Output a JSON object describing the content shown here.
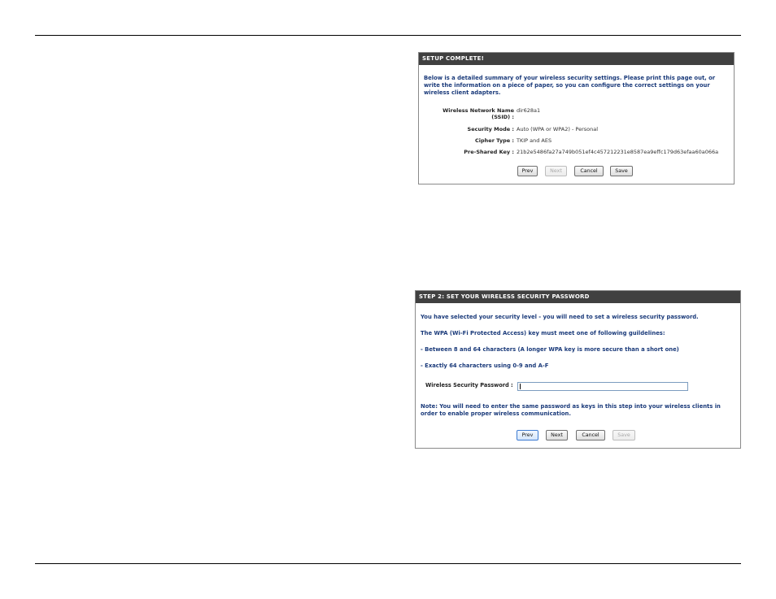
{
  "setup_complete": {
    "title": "SETUP COMPLETE!",
    "intro": "Below is a detailed summary of your wireless security settings. Please print this page out, or write the information on a piece of paper, so you can configure the correct settings on your wireless client adapters.",
    "fields": [
      {
        "label": "Wireless Network Name",
        "label2": "(SSID) :",
        "value": "dir628a1"
      },
      {
        "label": "Security Mode :",
        "value": "Auto (WPA or WPA2) - Personal"
      },
      {
        "label": "Cipher Type :",
        "value": "TKIP and AES"
      },
      {
        "label": "Pre-Shared Key :",
        "value": "21b2e5486fa27a749b051ef4c457212231e8587ea9effc179d63efaa60a066a"
      }
    ],
    "buttons": {
      "prev": "Prev",
      "next": "Next",
      "cancel": "Cancel",
      "save": "Save"
    },
    "next_enabled": false
  },
  "step2": {
    "title": "STEP 2: SET YOUR WIRELESS SECURITY PASSWORD",
    "lines": [
      "You have selected your security level - you will need to set a wireless security password.",
      "The WPA (Wi-Fi Protected Access) key must meet one of following guildelines:",
      "- Between 8 and 64 characters (A longer WPA key is more secure than a short one)",
      "- Exactly 64 characters using 0-9 and A-F"
    ],
    "password_label": "Wireless Security Password :",
    "password_value": "",
    "note": "Note: You will need to enter the same password as keys in this step into your wireless clients in order to enable proper wireless communication.",
    "buttons": {
      "prev": "Prev",
      "next": "Next",
      "cancel": "Cancel",
      "save": "Save"
    },
    "save_enabled": false
  }
}
